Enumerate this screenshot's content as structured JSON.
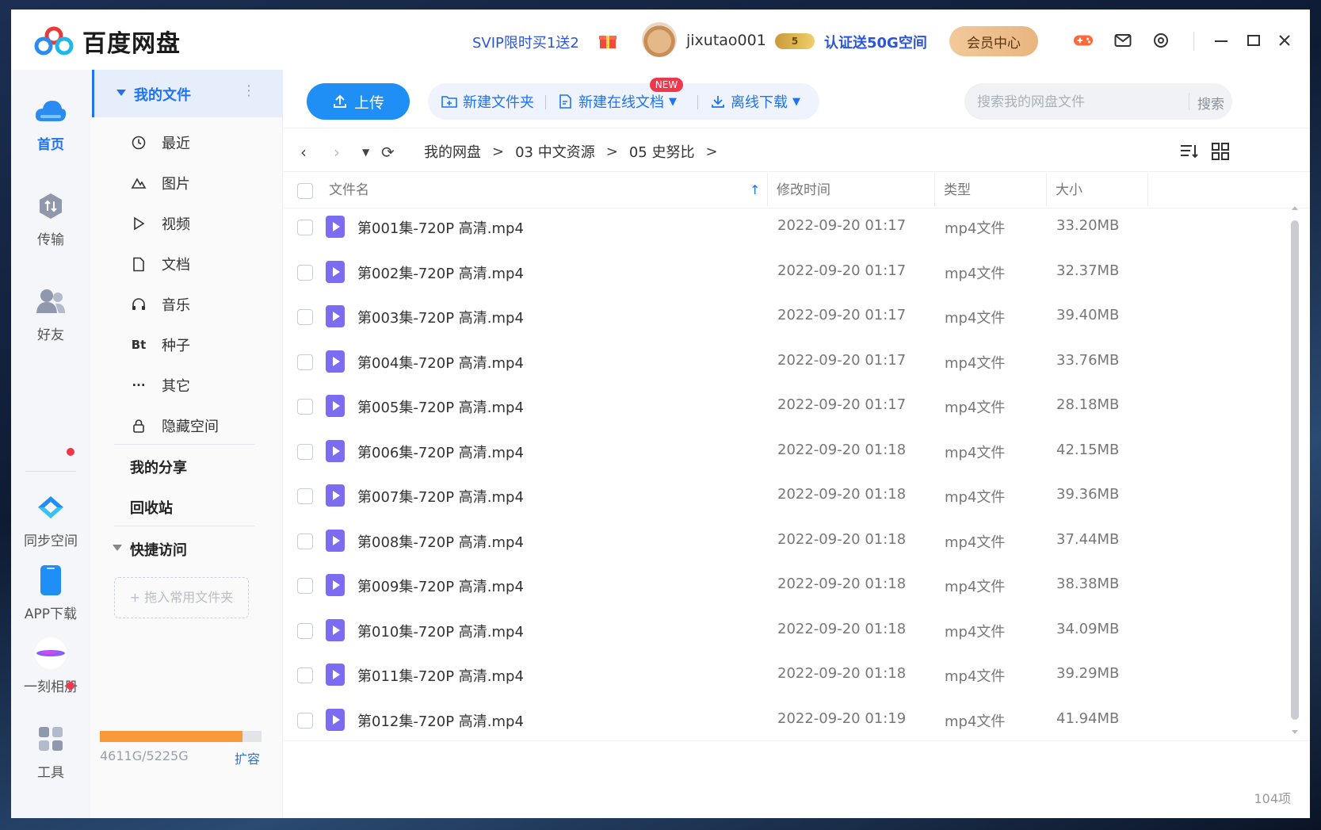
{
  "app": {
    "title": "百度网盘",
    "promo": "SVIP限时买1送2",
    "username": "jixutao001",
    "vip_badge": "5",
    "cert": "认证送50G空间",
    "member_center": "会员中心"
  },
  "left_nav": [
    {
      "label": "首页",
      "icon": "cloud-icon",
      "active": true
    },
    {
      "label": "传输",
      "icon": "transfer-icon"
    },
    {
      "label": "好友",
      "icon": "friends-icon"
    },
    {
      "label": "同步空间",
      "icon": "sync-space-icon"
    },
    {
      "label": "APP下载",
      "icon": "phone-icon"
    },
    {
      "label": "一刻相册",
      "icon": "album-icon"
    },
    {
      "label": "工具",
      "icon": "tools-icon"
    }
  ],
  "side": {
    "my_files": "我的文件",
    "items": [
      {
        "label": "最近",
        "icon": "clock-icon"
      },
      {
        "label": "图片",
        "icon": "image-icon"
      },
      {
        "label": "视频",
        "icon": "play-icon"
      },
      {
        "label": "文档",
        "icon": "document-icon"
      },
      {
        "label": "音乐",
        "icon": "headphones-icon"
      },
      {
        "label": "种子",
        "icon": "bt-icon",
        "glyph": "Bt"
      },
      {
        "label": "其它",
        "icon": "more-icon",
        "glyph": "···"
      },
      {
        "label": "隐藏空间",
        "icon": "lock-icon"
      }
    ],
    "my_share": "我的分享",
    "recycle": "回收站",
    "quick_access": "快捷访问",
    "drop_hint": "+ 拖入常用文件夹",
    "storage": "4611G/5225G",
    "storage_used_fraction": 0.883,
    "expand": "扩容"
  },
  "toolbar": {
    "upload": "上传",
    "new_folder": "新建文件夹",
    "new_doc": "新建在线文档",
    "new_badge": "NEW",
    "offline": "离线下载",
    "search_placeholder": "搜索我的网盘文件",
    "search_btn": "搜索"
  },
  "breadcrumb": [
    "我的网盘",
    "03 中文资源",
    "05 史努比"
  ],
  "columns": {
    "name": "文件名",
    "modified": "修改时间",
    "type": "类型",
    "size": "大小"
  },
  "files": [
    {
      "name": "第001集-720P 高清.mp4",
      "modified": "2022-09-20 01:17",
      "type": "mp4文件",
      "size": "33.20MB"
    },
    {
      "name": "第002集-720P 高清.mp4",
      "modified": "2022-09-20 01:17",
      "type": "mp4文件",
      "size": "32.37MB"
    },
    {
      "name": "第003集-720P 高清.mp4",
      "modified": "2022-09-20 01:17",
      "type": "mp4文件",
      "size": "39.40MB"
    },
    {
      "name": "第004集-720P 高清.mp4",
      "modified": "2022-09-20 01:17",
      "type": "mp4文件",
      "size": "33.76MB"
    },
    {
      "name": "第005集-720P 高清.mp4",
      "modified": "2022-09-20 01:17",
      "type": "mp4文件",
      "size": "28.18MB"
    },
    {
      "name": "第006集-720P 高清.mp4",
      "modified": "2022-09-20 01:18",
      "type": "mp4文件",
      "size": "42.15MB"
    },
    {
      "name": "第007集-720P 高清.mp4",
      "modified": "2022-09-20 01:18",
      "type": "mp4文件",
      "size": "39.36MB"
    },
    {
      "name": "第008集-720P 高清.mp4",
      "modified": "2022-09-20 01:18",
      "type": "mp4文件",
      "size": "37.44MB"
    },
    {
      "name": "第009集-720P 高清.mp4",
      "modified": "2022-09-20 01:18",
      "type": "mp4文件",
      "size": "38.38MB"
    },
    {
      "name": "第010集-720P 高清.mp4",
      "modified": "2022-09-20 01:18",
      "type": "mp4文件",
      "size": "34.09MB"
    },
    {
      "name": "第011集-720P 高清.mp4",
      "modified": "2022-09-20 01:18",
      "type": "mp4文件",
      "size": "39.29MB"
    },
    {
      "name": "第012集-720P 高清.mp4",
      "modified": "2022-09-20 01:19",
      "type": "mp4文件",
      "size": "41.94MB"
    }
  ],
  "item_count": "104项",
  "colors": {
    "accent": "#1f73f2",
    "upload": "#1f8ef5",
    "storage": "#f89a3b",
    "video_icon": "#7c6cf2"
  }
}
